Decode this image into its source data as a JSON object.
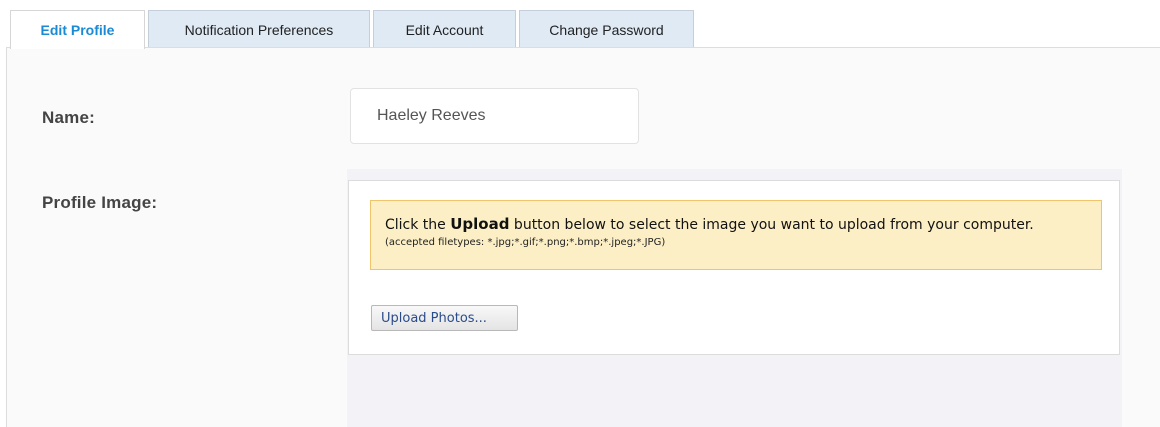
{
  "tabs": [
    {
      "label": "Edit Profile",
      "active": true
    },
    {
      "label": "Notification Preferences",
      "active": false
    },
    {
      "label": "Edit Account",
      "active": false
    },
    {
      "label": "Change Password",
      "active": false
    }
  ],
  "form": {
    "name_label": "Name:",
    "name_value": "Haeley Reeves",
    "profile_image_label": "Profile Image:"
  },
  "upload": {
    "notice_prefix": "Click the ",
    "notice_bold": "Upload",
    "notice_suffix": " button below to select the image you want to upload from your computer.",
    "accepted_types": "(accepted filetypes: *.jpg;*.gif;*.png;*.bmp;*.jpeg;*.JPG)",
    "button_label": "Upload Photos..."
  },
  "colors": {
    "active_tab_text": "#1a8ad4",
    "inactive_tab_bg": "#dfeaf5",
    "notice_bg": "#fcefc6",
    "notice_border": "#f0c46b",
    "upload_button_text": "#2b4c8a"
  }
}
